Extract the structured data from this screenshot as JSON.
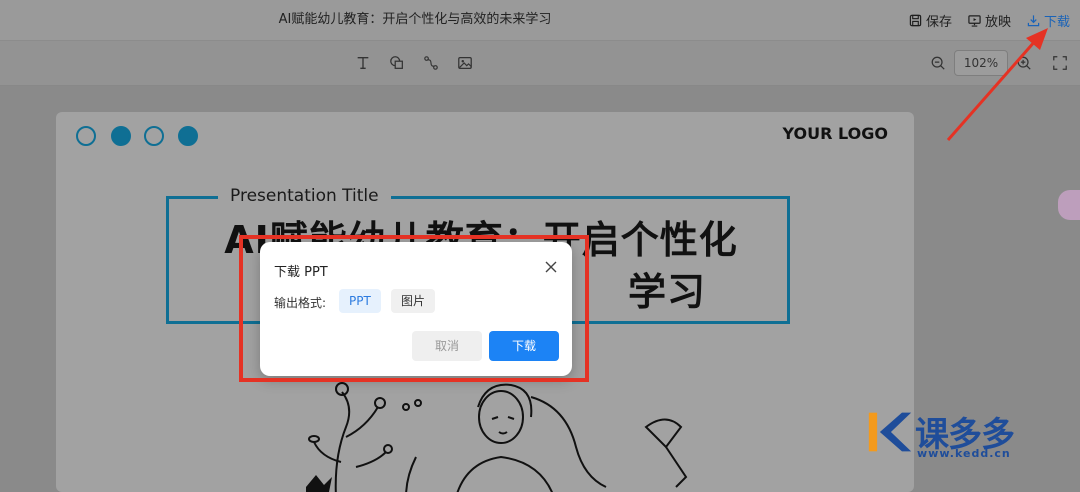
{
  "header": {
    "title": "AI赋能幼儿教育：开启个性化与高效的未来学习",
    "actions": {
      "save": "保存",
      "present": "放映",
      "download": "下载"
    }
  },
  "toolbar": {
    "tools": [
      "text-tool-icon",
      "shape-tool-icon",
      "line-tool-icon",
      "image-tool-icon"
    ],
    "zoom": "102%"
  },
  "slide": {
    "logo": "YOUR LOGO",
    "presentation_label": "Presentation Title",
    "title_line1": "AI赋能幼儿教育：开启个性化",
    "title_line2": "学习"
  },
  "dialog": {
    "title": "下载 PPT",
    "format_label": "输出格式:",
    "format_options": [
      "PPT",
      "图片"
    ],
    "selected_format": "PPT",
    "cancel_label": "取消",
    "confirm_label": "下载"
  },
  "watermark": {
    "brand": "课多多",
    "url": "www.kedd.cn"
  },
  "colors": {
    "accent": "#1c83f5",
    "slide_accent": "#0f6f94",
    "annotation_red": "#e53224",
    "brand_blue": "#1f4d9a",
    "brand_orange": "#f39a1d"
  }
}
